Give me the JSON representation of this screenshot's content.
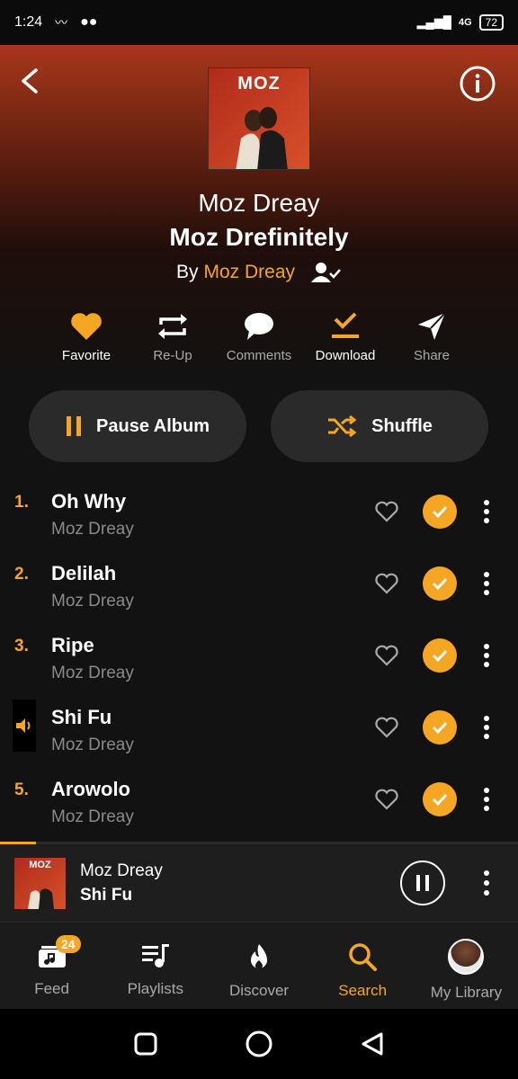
{
  "status": {
    "time": "1:24",
    "network": "4G",
    "battery": "72"
  },
  "album": {
    "artist": "Moz Dreay",
    "title": "Moz Drefinitely",
    "by_prefix": "By",
    "by_artist": "Moz Dreay",
    "cover_text": "MOZ"
  },
  "actions": [
    {
      "label": "Favorite",
      "icon": "heart-icon"
    },
    {
      "label": "Re-Up",
      "icon": "repeat-icon"
    },
    {
      "label": "Comments",
      "icon": "comment-icon"
    },
    {
      "label": "Download",
      "icon": "download-check-icon"
    },
    {
      "label": "Share",
      "icon": "share-icon"
    }
  ],
  "buttons": {
    "pause_label": "Pause Album",
    "shuffle_label": "Shuffle"
  },
  "tracks": [
    {
      "num": "1.",
      "title": "Oh Why",
      "artist": "Moz Dreay"
    },
    {
      "num": "2.",
      "title": "Delilah",
      "artist": "Moz Dreay"
    },
    {
      "num": "3.",
      "title": "Ripe",
      "artist": "Moz Dreay"
    },
    {
      "num": "",
      "title": "Shi Fu",
      "artist": "Moz Dreay",
      "playing": true
    },
    {
      "num": "5.",
      "title": "Arowolo",
      "artist": "Moz Dreay"
    }
  ],
  "player": {
    "artist": "Moz Dreay",
    "track": "Shi Fu",
    "progress": 0.07,
    "cover_text": "MOZ"
  },
  "nav": [
    {
      "label": "Feed",
      "badge": "24"
    },
    {
      "label": "Playlists"
    },
    {
      "label": "Discover"
    },
    {
      "label": "Search",
      "active": true
    },
    {
      "label": "My Library"
    }
  ],
  "colors": {
    "accent": "#f5a623",
    "background": "#121212",
    "header_top": "#a8371a"
  }
}
